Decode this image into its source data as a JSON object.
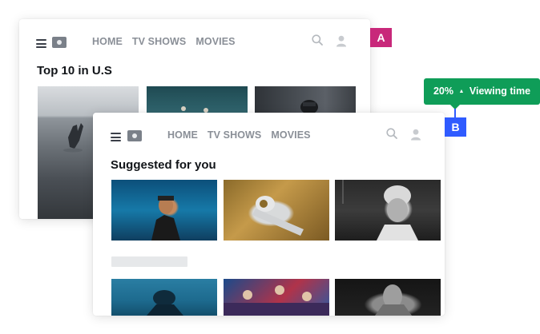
{
  "colors": {
    "tag_a": "#c8287a",
    "tag_b": "#2f5bff",
    "tooltip_bg": "#0f9d58",
    "nav_text": "#8a8f97"
  },
  "card_a": {
    "nav": {
      "home": "HOME",
      "tv_shows": "TV SHOWS",
      "movies": "MOVIES"
    },
    "section_title": "Top 10 in U.S",
    "tag": "A",
    "icons": {
      "menu": "hamburger-icon",
      "logo": "logo-icon",
      "search": "search-icon",
      "user": "user-icon"
    }
  },
  "card_b": {
    "nav": {
      "home": "HOME",
      "tv_shows": "TV SHOWS",
      "movies": "MOVIES"
    },
    "section_title": "Suggested for you",
    "tag": "B",
    "icons": {
      "menu": "hamburger-icon",
      "logo": "logo-icon",
      "search": "search-icon",
      "user": "user-icon"
    }
  },
  "tooltip": {
    "value": "20%",
    "label": "Viewing time",
    "trend_icon": "triangle-up-icon"
  }
}
